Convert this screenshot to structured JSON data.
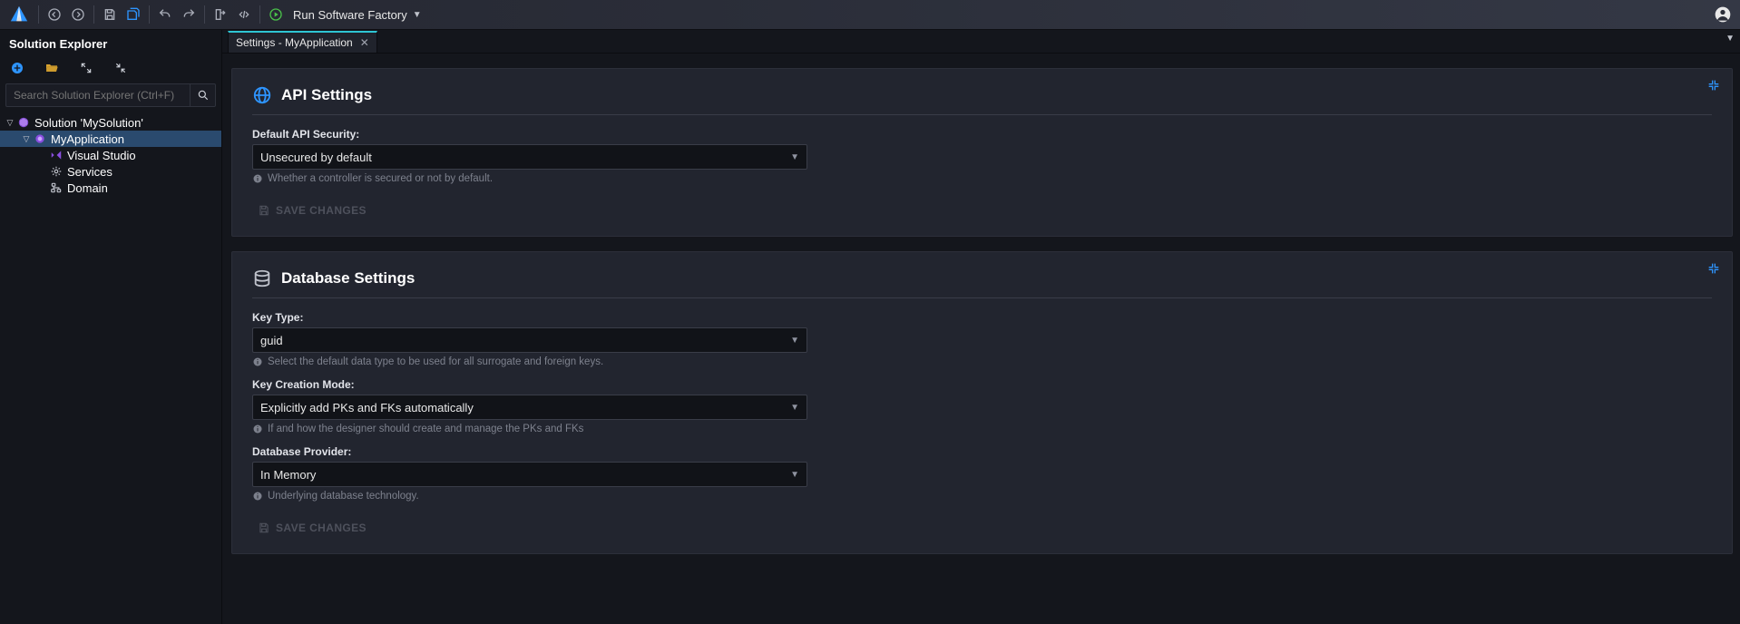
{
  "toolbar": {
    "run_label": "Run Software Factory"
  },
  "sidebar": {
    "title": "Solution Explorer",
    "search_placeholder": "Search Solution Explorer (Ctrl+F)",
    "tree": {
      "solution_label": "Solution 'MySolution'",
      "app_label": "MyApplication",
      "children": [
        {
          "label": "Visual Studio",
          "icon": "visual-studio"
        },
        {
          "label": "Services",
          "icon": "services-gear"
        },
        {
          "label": "Domain",
          "icon": "domain-diagram"
        }
      ]
    }
  },
  "tabs": {
    "active_label": "Settings - MyApplication"
  },
  "panels": {
    "api": {
      "title": "API Settings",
      "fields": {
        "default_api_security": {
          "label": "Default API Security:",
          "value": "Unsecured by default",
          "hint": "Whether a controller is secured or not by default."
        }
      },
      "save_label": "SAVE CHANGES"
    },
    "db": {
      "title": "Database Settings",
      "fields": {
        "key_type": {
          "label": "Key Type:",
          "value": "guid",
          "hint": "Select the default data type to be used for all surrogate and foreign keys."
        },
        "key_creation": {
          "label": "Key Creation Mode:",
          "value": "Explicitly add PKs and FKs automatically",
          "hint": "If and how the designer should create and manage the PKs and FKs"
        },
        "db_provider": {
          "label": "Database Provider:",
          "value": "In Memory",
          "hint": "Underlying database technology."
        }
      },
      "save_label": "SAVE CHANGES"
    }
  }
}
